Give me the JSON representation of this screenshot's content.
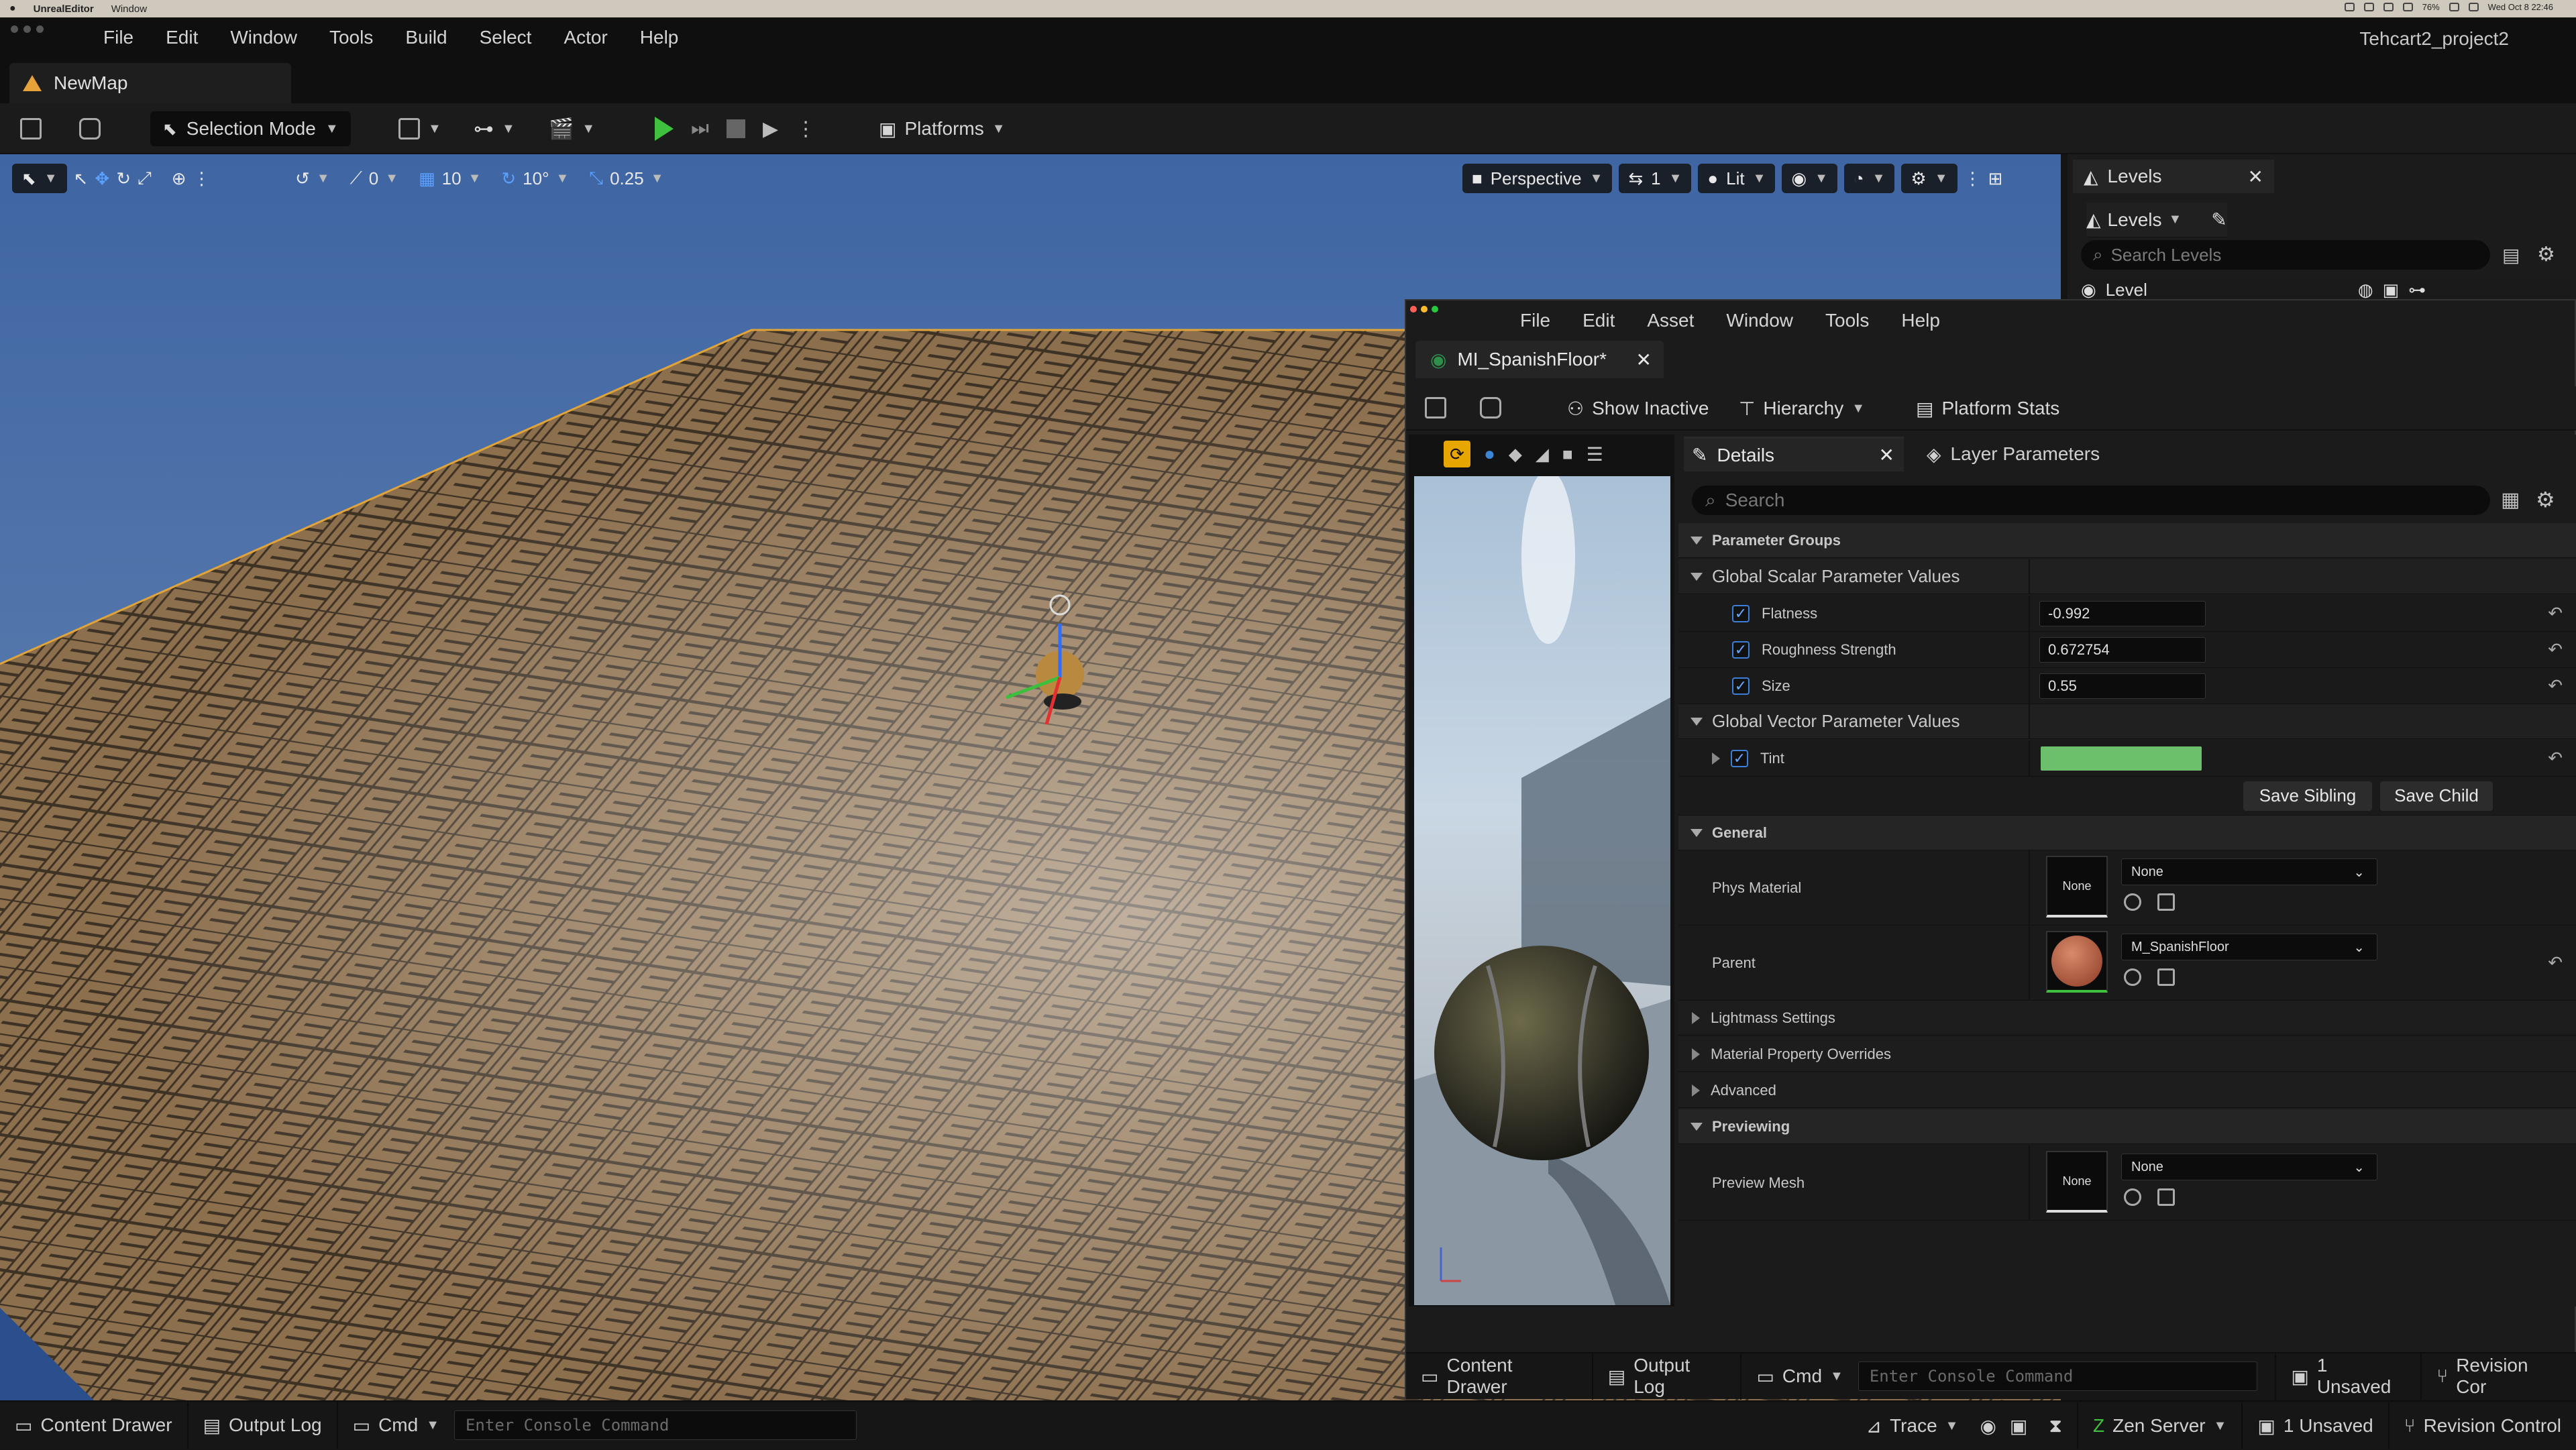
{
  "macbar": {
    "app": "UnrealEditor",
    "menu": "Window",
    "clock": "Wed Oct 8 22:46",
    "battery": "76%"
  },
  "title_menu": [
    "File",
    "Edit",
    "Window",
    "Tools",
    "Build",
    "Select",
    "Actor",
    "Help"
  ],
  "project_name": "Tehcart2_project2",
  "map_tab": "NewMap",
  "toolbar": {
    "selection_mode": "Selection Mode",
    "platforms": "Platforms"
  },
  "viewport": {
    "snap_rotate": "0",
    "grid_size": "10",
    "rotate_snap": "10°",
    "scale_snap": "0.25",
    "perspective": "Perspective",
    "camera_speed": "1",
    "lit": "Lit",
    "sky_color": "#4c73aa",
    "floor_color": "#8a6e4e"
  },
  "levels_panel": {
    "tab": "Levels",
    "dropdown": "Levels",
    "search_placeholder": "Search Levels",
    "row": "Level"
  },
  "material_editor": {
    "menu": [
      "File",
      "Edit",
      "Asset",
      "Window",
      "Tools",
      "Help"
    ],
    "tab": "MI_SpanishFloor*",
    "toolbar": {
      "show_inactive": "Show Inactive",
      "hierarchy": "Hierarchy",
      "platform_stats": "Platform Stats"
    },
    "details_tab": "Details",
    "layer_tab": "Layer Parameters",
    "search_placeholder": "Search",
    "groups": {
      "parameter_groups": "Parameter Groups",
      "scalar": "Global Scalar Parameter Values",
      "vector": "Global Vector Parameter Values",
      "general": "General",
      "previewing": "Previewing"
    },
    "scalars": [
      {
        "name": "Flatness",
        "value": "-0.992"
      },
      {
        "name": "Roughness Strength",
        "value": "0.672754"
      },
      {
        "name": "Size",
        "value": "0.55"
      }
    ],
    "tint": {
      "name": "Tint",
      "color": "#6cc06c"
    },
    "save_sibling": "Save Sibling",
    "save_child": "Save Child",
    "phys_material": {
      "label": "Phys Material",
      "thumb": "None",
      "value": "None"
    },
    "parent": {
      "label": "Parent",
      "value": "M_SpanishFloor"
    },
    "collapsed": [
      "Lightmass Settings",
      "Material Property Overrides",
      "Advanced"
    ],
    "preview_mesh": {
      "label": "Preview Mesh",
      "thumb": "None",
      "value": "None"
    },
    "status": {
      "content_drawer": "Content Drawer",
      "output_log": "Output Log",
      "cmd": "Cmd",
      "console_placeholder": "Enter Console Command",
      "unsaved": "1 Unsaved",
      "revision": "Revision Cor"
    }
  },
  "statusbar": {
    "content_drawer": "Content Drawer",
    "output_log": "Output Log",
    "cmd": "Cmd",
    "console_placeholder": "Enter Console Command",
    "trace": "Trace",
    "zen_server": "Zen Server",
    "unsaved": "1 Unsaved",
    "revision_control": "Revision Control"
  }
}
